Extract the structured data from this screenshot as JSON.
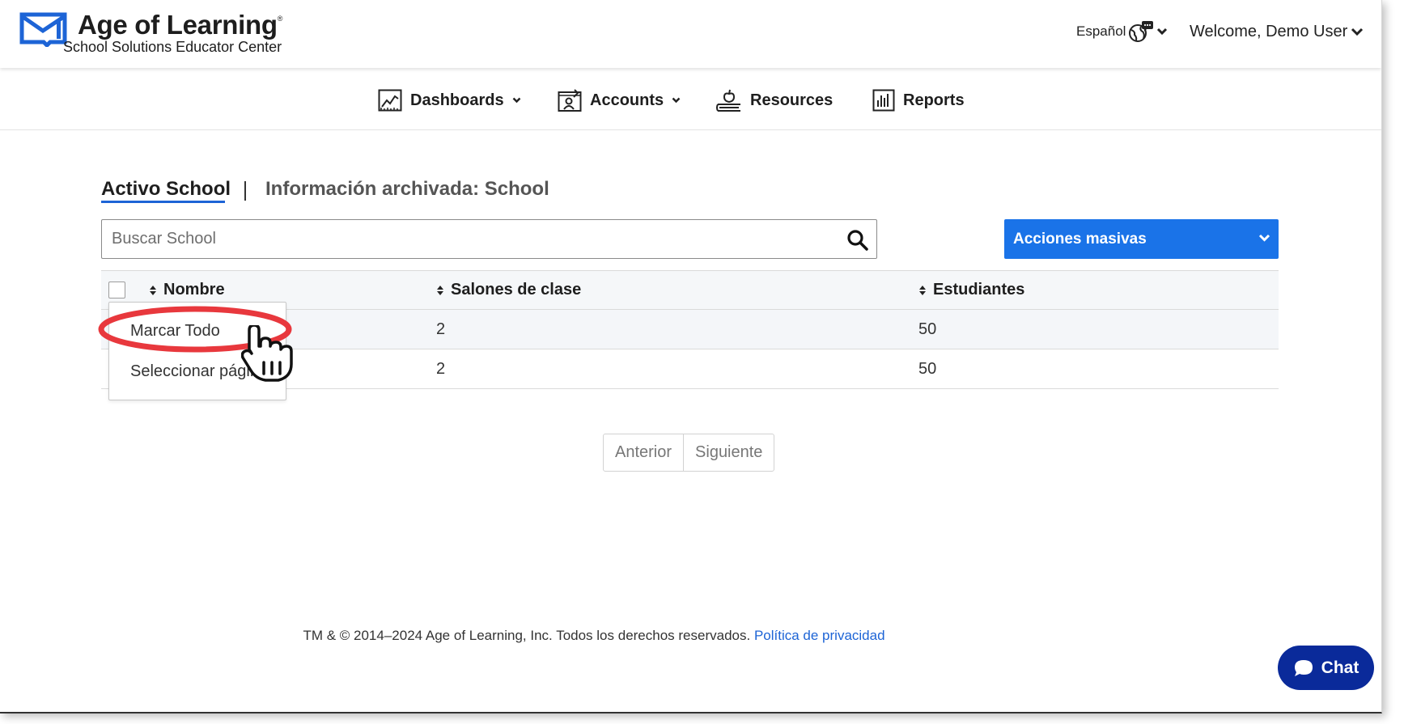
{
  "header": {
    "logo_title": "Age of Learning",
    "logo_trademark": "®",
    "logo_subtitle": "School Solutions Educator Center",
    "language_label": "Español",
    "welcome_label": "Welcome, Demo User"
  },
  "nav": {
    "items": [
      {
        "label": "Dashboards",
        "icon": "line-chart-icon"
      },
      {
        "label": "Accounts",
        "icon": "accounts-icon"
      },
      {
        "label": "Resources",
        "icon": "apple-books-icon"
      },
      {
        "label": "Reports",
        "icon": "bar-chart-icon"
      }
    ]
  },
  "tabs": {
    "active": "Activo School",
    "archived": "Información archivada: School"
  },
  "search": {
    "placeholder": "Buscar School",
    "value": ""
  },
  "bulk_actions": {
    "label": "Acciones masivas"
  },
  "table": {
    "columns": [
      "Nombre",
      "Salones de clase",
      "Estudiantes"
    ],
    "rows": [
      {
        "name": "",
        "classrooms": "2",
        "students": "50"
      },
      {
        "name": "",
        "classrooms": "2",
        "students": "50"
      }
    ]
  },
  "select_menu": {
    "items": [
      "Marcar Todo",
      "Seleccionar página"
    ]
  },
  "pagination": {
    "previous": "Anterior",
    "next": "Siguiente"
  },
  "footer": {
    "copyright": "TM & © 2014–2024 Age of Learning, Inc. Todos los derechos reservados.",
    "privacy_link": "Política de privacidad"
  },
  "chat": {
    "label": "Chat"
  },
  "colors": {
    "accent_blue": "#1a73e8",
    "chat_navy": "#0a2a9a",
    "highlight_red": "#e8383d",
    "link_blue": "#1d64d6"
  }
}
